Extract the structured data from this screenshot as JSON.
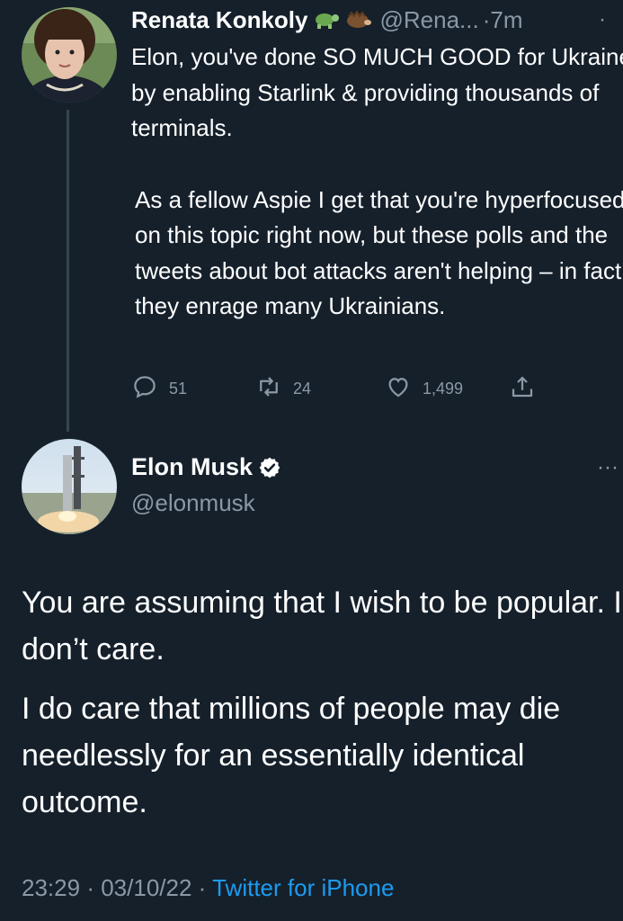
{
  "tweet1": {
    "name": "Renata Konkoly",
    "emojis": [
      "turtle-emoji",
      "hedgehog-emoji"
    ],
    "handle": "@Rena...",
    "separator": "·",
    "time": "7m",
    "paragraphs": [
      "Elon, you've done SO MUCH GOOD for Ukraine by enabling Starlink & providing thousands of terminals.",
      "As a fellow Aspie I get that you're hyperfocused on this topic right now, but these polls and the tweets about bot attacks aren't helping – in fact, they enrage many Ukrainians."
    ],
    "replies": "51",
    "retweets": "24",
    "likes": "1,499"
  },
  "tweet2": {
    "name": "Elon Musk",
    "handle": "@elonmusk",
    "more": "···",
    "paragraphs": [
      "You are assuming that I wish to be popular. I don’t care.",
      "I do care that millions of people may die needlessly for an essentially identical outcome."
    ],
    "time": "23:29",
    "date": "03/10/22",
    "dot": "·",
    "source": "Twitter for iPhone"
  },
  "colors": {
    "background": "#15202b",
    "muted": "#8b98a5",
    "link": "#1d9bf0",
    "text": "#ffffff"
  }
}
